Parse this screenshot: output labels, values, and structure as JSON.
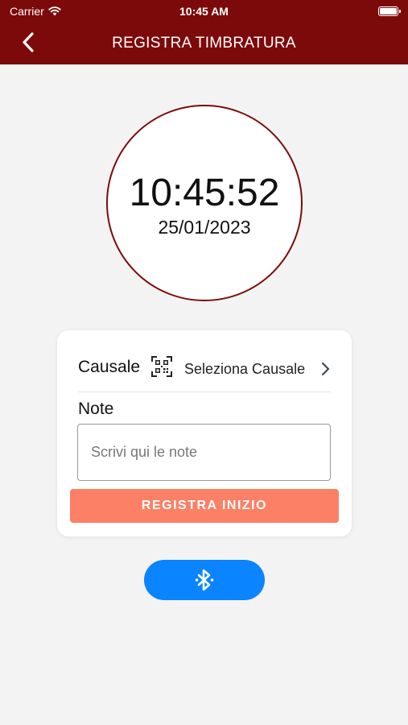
{
  "status_bar": {
    "carrier": "Carrier",
    "time": "10:45 AM"
  },
  "header": {
    "title": "REGISTRA TIMBRATURA",
    "back_icon": "chevron-left-icon",
    "background_color": "#7d0a0a"
  },
  "clock": {
    "time": "10:45:52",
    "date": "25/01/2023",
    "border_color": "#7d0a0a"
  },
  "form": {
    "causale_label": "Causale",
    "causale_icon": "qr-code-icon",
    "causale_value": "Seleziona Causale",
    "note_label": "Note",
    "note_placeholder": "Scrivi qui le note",
    "note_value": "",
    "submit_label": "REGISTRA INIZIO",
    "submit_color": "#fb8066"
  },
  "bluetooth_button": {
    "icon": "bluetooth-icon",
    "color": "#0a84ff"
  }
}
